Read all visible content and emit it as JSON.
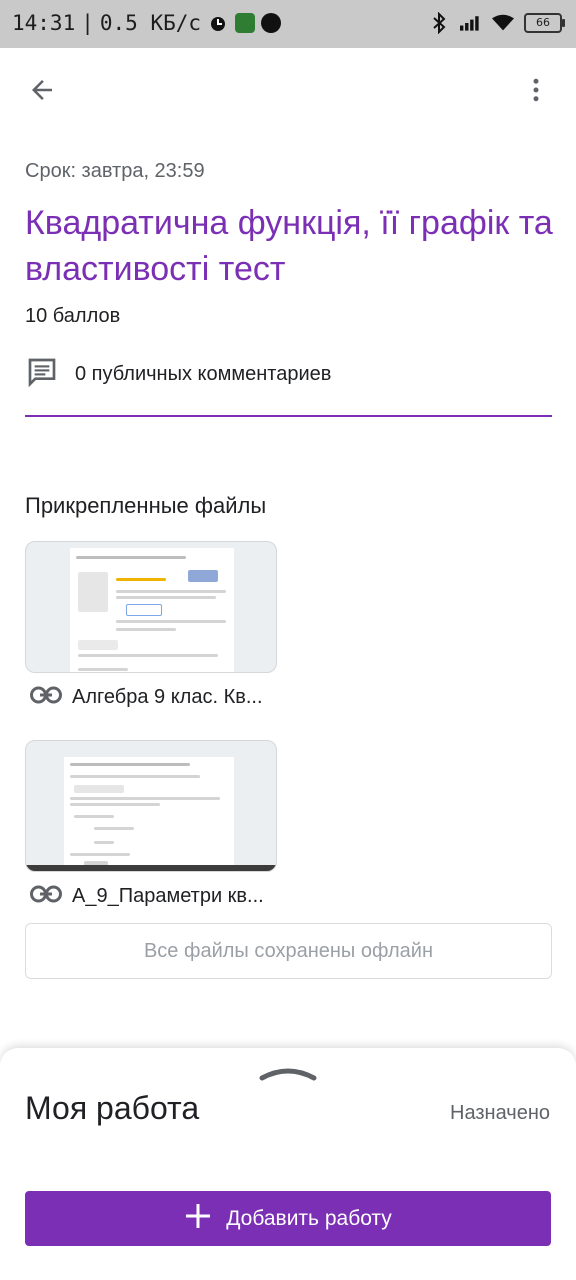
{
  "status_bar": {
    "time": "14:31",
    "separator": "|",
    "speed": "0.5 КБ/с",
    "battery": "66",
    "icons": [
      "alarm-icon",
      "app-icon",
      "app-icon",
      "bluetooth-icon",
      "signal-icon",
      "wifi-icon",
      "battery-icon"
    ]
  },
  "header": {
    "back_icon": "arrow-back-icon",
    "menu_icon": "more-vert-icon"
  },
  "assignment": {
    "due": "Срок: завтра, 23:59",
    "title": "Квадратична функція, її графік та властивості тест",
    "points": "10 баллов",
    "comments": "0 публичных комментариев",
    "accent_color": "#7b2fb5"
  },
  "attachments": {
    "heading": "Прикрепленные файлы",
    "items": [
      {
        "name": "Алгебра 9 клас. Кв...",
        "icon": "link-icon"
      },
      {
        "name": "А_9_Параметри кв...",
        "icon": "link-icon"
      }
    ],
    "offline_note": "Все файлы сохранены офлайн"
  },
  "my_work": {
    "title": "Моя работа",
    "status": "Назначено",
    "add_button": "Добавить работу"
  }
}
